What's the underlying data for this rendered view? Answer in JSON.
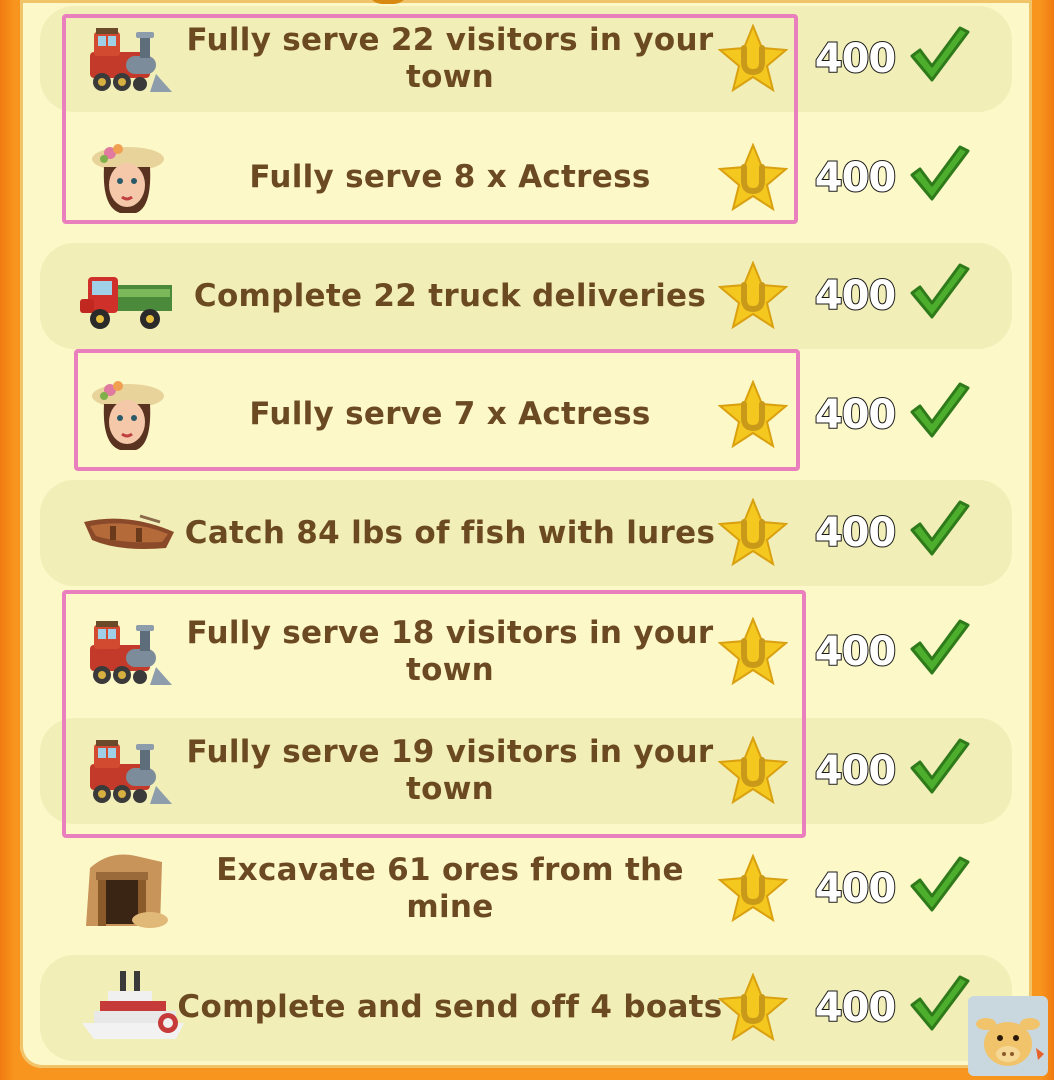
{
  "quests": [
    {
      "icon": "train-icon",
      "text": "Fully serve 22 visitors in your town",
      "reward": "400",
      "shaded": true
    },
    {
      "icon": "actress-icon",
      "text": "Fully serve 8 x Actress",
      "reward": "400",
      "shaded": false
    },
    {
      "icon": "truck-icon",
      "text": "Complete 22 truck deliveries",
      "reward": "400",
      "shaded": true
    },
    {
      "icon": "actress-icon",
      "text": "Fully serve 7 x Actress",
      "reward": "400",
      "shaded": false
    },
    {
      "icon": "rowboat-icon",
      "text": "Catch 84 lbs of fish with lures",
      "reward": "400",
      "shaded": true
    },
    {
      "icon": "train-icon",
      "text": "Fully serve 18 visitors in your town",
      "reward": "400",
      "shaded": false
    },
    {
      "icon": "train-icon",
      "text": "Fully serve 19 visitors in your town",
      "reward": "400",
      "shaded": true
    },
    {
      "icon": "mine-icon",
      "text": "Excavate 61 ores from the mine",
      "reward": "400",
      "shaded": false
    },
    {
      "icon": "steamboat-icon",
      "text": "Complete and send off 4 boats",
      "reward": "400",
      "shaded": true
    }
  ],
  "colors": {
    "frame": "#f8951e",
    "panel": "#fdf8c8",
    "band": "#f1eeb7",
    "text": "#6b4a22",
    "highlight": "#ea7fbe",
    "check": "#4cae2c",
    "star": "#f5c81f"
  }
}
